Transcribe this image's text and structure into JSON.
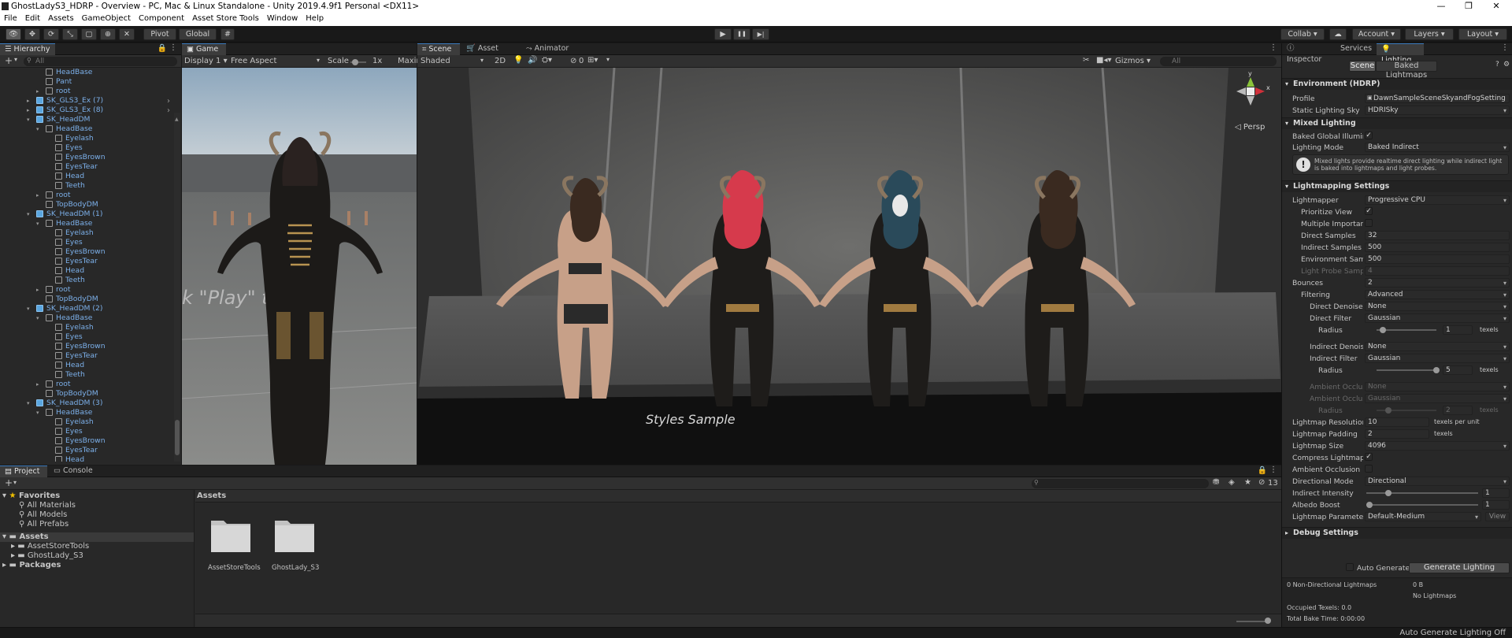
{
  "window": {
    "title": "GhostLadyS3_HDRP - Overview - PC, Mac & Linux Standalone - Unity 2019.4.9f1 Personal <DX11>",
    "minimize": "—",
    "maximize": "❐",
    "close": "✕"
  },
  "menu": [
    "File",
    "Edit",
    "Assets",
    "GameObject",
    "Component",
    "Asset Store Tools",
    "Window",
    "Help"
  ],
  "toolbar": {
    "pivot": "Pivot",
    "global": "Global",
    "collab": "Collab",
    "account": "Account",
    "layers": "Layers",
    "layout": "Layout",
    "play": "▶",
    "pause": "❚❚",
    "step": "▶|"
  },
  "hierarchy": {
    "tab": "Hierarchy",
    "search_placeholder": "All",
    "add": "+",
    "rows": [
      {
        "d": 4,
        "t": "HeadBase",
        "a": "",
        "c": "mesh"
      },
      {
        "d": 4,
        "t": "Pant",
        "a": "",
        "c": "mesh"
      },
      {
        "d": 4,
        "t": "root",
        "a": "▸",
        "c": "mesh"
      },
      {
        "d": 3,
        "t": "SK_GLS3_Ex (7)",
        "a": "▸",
        "c": "prefab",
        "r": "›"
      },
      {
        "d": 3,
        "t": "SK_GLS3_Ex (8)",
        "a": "▸",
        "c": "prefab",
        "r": "›"
      },
      {
        "d": 3,
        "t": "SK_HeadDM",
        "a": "▾",
        "c": "prefab"
      },
      {
        "d": 4,
        "t": "HeadBase",
        "a": "▾",
        "c": "mesh"
      },
      {
        "d": 5,
        "t": "Eyelash",
        "a": "",
        "c": "mesh"
      },
      {
        "d": 5,
        "t": "Eyes",
        "a": "",
        "c": "mesh"
      },
      {
        "d": 5,
        "t": "EyesBrown",
        "a": "",
        "c": "mesh"
      },
      {
        "d": 5,
        "t": "EyesTear",
        "a": "",
        "c": "mesh"
      },
      {
        "d": 5,
        "t": "Head",
        "a": "",
        "c": "mesh"
      },
      {
        "d": 5,
        "t": "Teeth",
        "a": "",
        "c": "mesh"
      },
      {
        "d": 4,
        "t": "root",
        "a": "▸",
        "c": "mesh"
      },
      {
        "d": 4,
        "t": "TopBodyDM",
        "a": "",
        "c": "mesh"
      },
      {
        "d": 3,
        "t": "SK_HeadDM (1)",
        "a": "▾",
        "c": "prefab"
      },
      {
        "d": 4,
        "t": "HeadBase",
        "a": "▾",
        "c": "mesh"
      },
      {
        "d": 5,
        "t": "Eyelash",
        "a": "",
        "c": "mesh"
      },
      {
        "d": 5,
        "t": "Eyes",
        "a": "",
        "c": "mesh"
      },
      {
        "d": 5,
        "t": "EyesBrown",
        "a": "",
        "c": "mesh"
      },
      {
        "d": 5,
        "t": "EyesTear",
        "a": "",
        "c": "mesh"
      },
      {
        "d": 5,
        "t": "Head",
        "a": "",
        "c": "mesh"
      },
      {
        "d": 5,
        "t": "Teeth",
        "a": "",
        "c": "mesh"
      },
      {
        "d": 4,
        "t": "root",
        "a": "▸",
        "c": "mesh"
      },
      {
        "d": 4,
        "t": "TopBodyDM",
        "a": "",
        "c": "mesh"
      },
      {
        "d": 3,
        "t": "SK_HeadDM (2)",
        "a": "▾",
        "c": "prefab"
      },
      {
        "d": 4,
        "t": "HeadBase",
        "a": "▾",
        "c": "mesh"
      },
      {
        "d": 5,
        "t": "Eyelash",
        "a": "",
        "c": "mesh"
      },
      {
        "d": 5,
        "t": "Eyes",
        "a": "",
        "c": "mesh"
      },
      {
        "d": 5,
        "t": "EyesBrown",
        "a": "",
        "c": "mesh"
      },
      {
        "d": 5,
        "t": "EyesTear",
        "a": "",
        "c": "mesh"
      },
      {
        "d": 5,
        "t": "Head",
        "a": "",
        "c": "mesh"
      },
      {
        "d": 5,
        "t": "Teeth",
        "a": "",
        "c": "mesh"
      },
      {
        "d": 4,
        "t": "root",
        "a": "▸",
        "c": "mesh"
      },
      {
        "d": 4,
        "t": "TopBodyDM",
        "a": "",
        "c": "mesh"
      },
      {
        "d": 3,
        "t": "SK_HeadDM (3)",
        "a": "▾",
        "c": "prefab"
      },
      {
        "d": 4,
        "t": "HeadBase",
        "a": "▾",
        "c": "mesh"
      },
      {
        "d": 5,
        "t": "Eyelash",
        "a": "",
        "c": "mesh"
      },
      {
        "d": 5,
        "t": "Eyes",
        "a": "",
        "c": "mesh"
      },
      {
        "d": 5,
        "t": "EyesBrown",
        "a": "",
        "c": "mesh"
      },
      {
        "d": 5,
        "t": "EyesTear",
        "a": "",
        "c": "mesh"
      },
      {
        "d": 5,
        "t": "Head",
        "a": "",
        "c": "mesh"
      }
    ]
  },
  "game": {
    "tab": "Game",
    "display": "Display 1",
    "aspect": "Free Aspect",
    "scale_label": "Scale",
    "scale_value": "1x",
    "maximize": "Maxim",
    "overlay_text": "k \"Play\" to beg"
  },
  "scene": {
    "tab": "Scene",
    "tab2": "Asset Store",
    "tab3": "Animator",
    "shading": "Shaded",
    "mode2d": "2D",
    "gizmos": "Gizmos",
    "search_placeholder": "All",
    "persp": "◁ Persp",
    "fx_count": "0",
    "label": "Styles Sample"
  },
  "project": {
    "tab": "Project",
    "tab2": "Console",
    "favorites": "Favorites",
    "fav_items": [
      "All Materials",
      "All Models",
      "All Prefabs"
    ],
    "assets": "Assets",
    "asset_children": [
      "AssetStoreTools",
      "GhostLady_S3"
    ],
    "packages": "Packages",
    "breadcrumb": "Assets",
    "folders": [
      "AssetStoreTools",
      "GhostLady_S3"
    ],
    "count": "13"
  },
  "inspector": {
    "tabs": [
      "Inspector",
      "Services",
      "Lighting"
    ],
    "scene_btn": "Scene",
    "baked_btn": "Baked Lightmaps",
    "env": {
      "header": "Environment (HDRP)",
      "profile_l": "Profile",
      "profile_v": "DawnSampleSceneSkyandFogSetting",
      "sky_l": "Static Lighting Sky",
      "sky_v": "HDRISky"
    },
    "mixed": {
      "header": "Mixed Lighting",
      "bgi_l": "Baked Global Illumina",
      "mode_l": "Lighting Mode",
      "mode_v": "Baked Indirect",
      "info": "Mixed lights provide realtime direct lighting while indirect light is baked into lightmaps and light probes."
    },
    "lm": {
      "header": "Lightmapping Settings",
      "lightmapper_l": "Lightmapper",
      "lightmapper_v": "Progressive CPU",
      "prio_l": "Prioritize View",
      "multi_l": "Multiple Importanc",
      "direct_l": "Direct Samples",
      "direct_v": "32",
      "indirect_l": "Indirect Samples",
      "indirect_v": "500",
      "env_l": "Environment Samp",
      "env_v": "500",
      "probe_l": "Light Probe Sampl",
      "probe_v": "4",
      "bounces_l": "Bounces",
      "bounces_v": "2",
      "filter_l": "Filtering",
      "filter_v": "Advanced",
      "dden_l": "Direct Denoiser",
      "dden_v": "None",
      "dfil_l": "Direct Filter",
      "dfil_v": "Gaussian",
      "radius_l": "Radius",
      "dradius_v": "1",
      "texels": "texels",
      "iden_l": "Indirect Denoise",
      "iden_v": "None",
      "ifil_l": "Indirect Filter",
      "ifil_v": "Gaussian",
      "iradius_v": "5",
      "aoc1_l": "Ambient Occlus",
      "aoc1_v": "None",
      "aoc2_l": "Ambient Occlus",
      "aoc2_v": "Gaussian",
      "aradius_v": "2",
      "res_l": "Lightmap Resolution",
      "res_v": "10",
      "res_unit": "texels per unit",
      "pad_l": "Lightmap Padding",
      "pad_v": "2",
      "pad_unit": "texels",
      "size_l": "Lightmap Size",
      "size_v": "4096",
      "compress_l": "Compress Lightmaps",
      "ao_l": "Ambient Occlusion",
      "dirmode_l": "Directional Mode",
      "dirmode_v": "Directional",
      "intensity_l": "Indirect Intensity",
      "intensity_v": "1",
      "albedo_l": "Albedo Boost",
      "albedo_v": "1",
      "params_l": "Lightmap Parameters",
      "params_v": "Default-Medium",
      "view_btn": "View"
    },
    "debug": "Debug Settings",
    "auto_l": "Auto Generate",
    "generate_btn": "Generate Lighting",
    "stats": {
      "nondir": "0 Non-Directional Lightmaps",
      "size": "0 B",
      "nolm": "No Lightmaps",
      "occupied": "Occupied Texels: 0.0",
      "bake": "Total Bake Time: 0:00:00"
    }
  },
  "statusbar": "Auto Generate Lighting Off",
  "colors": {
    "accent": "#3a79bb",
    "prefab": "#7cb0ea"
  }
}
